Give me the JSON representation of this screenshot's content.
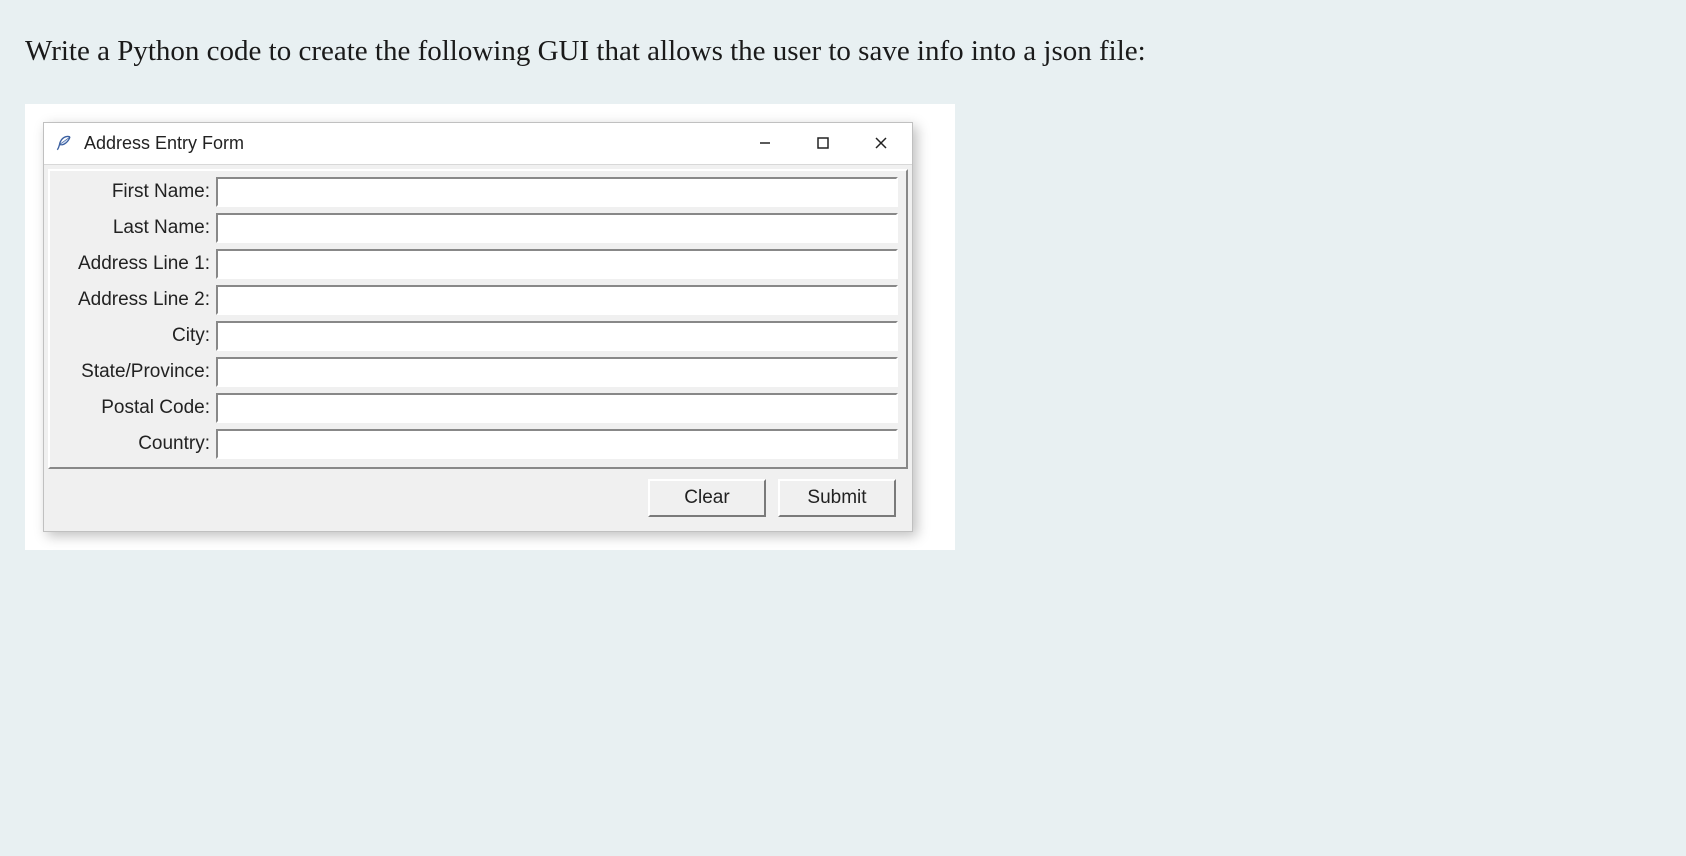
{
  "question": "Write a Python code to create the following GUI that allows the user to save info into a json file:",
  "window": {
    "title": "Address Entry Form",
    "fields": [
      {
        "label": "First Name:",
        "value": ""
      },
      {
        "label": "Last Name:",
        "value": ""
      },
      {
        "label": "Address Line 1:",
        "value": ""
      },
      {
        "label": "Address Line 2:",
        "value": ""
      },
      {
        "label": "City:",
        "value": ""
      },
      {
        "label": "State/Province:",
        "value": ""
      },
      {
        "label": "Postal Code:",
        "value": ""
      },
      {
        "label": "Country:",
        "value": ""
      }
    ],
    "buttons": {
      "clear": "Clear",
      "submit": "Submit"
    }
  }
}
